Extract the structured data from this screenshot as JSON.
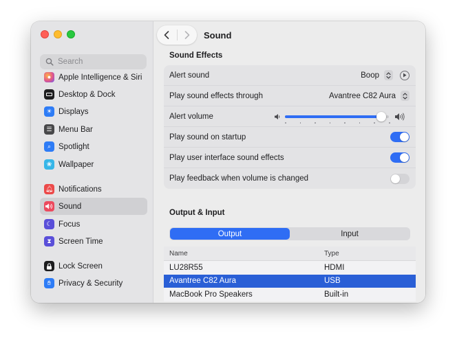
{
  "sidebar": {
    "search_placeholder": "Search",
    "items": [
      {
        "label": "Apple Intelligence & Siri",
        "color": "#e0568c"
      },
      {
        "label": "Desktop & Dock",
        "color": "#1d1d1f"
      },
      {
        "label": "Displays",
        "color": "#2e7cf6"
      },
      {
        "label": "Menu Bar",
        "color": "#1d1d1f"
      },
      {
        "label": "Spotlight",
        "color": "#2e7cf6"
      },
      {
        "label": "Wallpaper",
        "color": "#36b6e8"
      },
      {
        "label": "Notifications",
        "color": "#ec4a4a"
      },
      {
        "label": "Sound",
        "color": "#ec4a5e"
      },
      {
        "label": "Focus",
        "color": "#5a4fd9"
      },
      {
        "label": "Screen Time",
        "color": "#5a4fd9"
      },
      {
        "label": "Lock Screen",
        "color": "#1d1d1f"
      },
      {
        "label": "Privacy & Security",
        "color": "#2e7cf6"
      }
    ]
  },
  "header": {
    "title": "Sound"
  },
  "sound_effects": {
    "title": "Sound Effects",
    "alert_sound_label": "Alert sound",
    "alert_sound_value": "Boop",
    "output_through_label": "Play sound effects through",
    "output_through_value": "Avantree C82 Aura",
    "alert_volume_label": "Alert volume",
    "alert_volume_level": 0.93,
    "startup_label": "Play sound on startup",
    "startup_on": true,
    "ui_effects_label": "Play user interface sound effects",
    "ui_effects_on": true,
    "feedback_label": "Play feedback when volume is changed",
    "feedback_on": false
  },
  "output_input": {
    "title": "Output & Input",
    "tabs": [
      "Output",
      "Input"
    ],
    "active_tab": "Output",
    "columns": [
      "Name",
      "Type"
    ],
    "rows": [
      {
        "name": "LU28R55",
        "type": "HDMI"
      },
      {
        "name": "Avantree C82 Aura",
        "type": "USB"
      },
      {
        "name": "MacBook Pro Speakers",
        "type": "Built-in"
      }
    ],
    "selected_row": 1
  },
  "colors": {
    "accent": "#2f6df4",
    "selection": "#2a5fd6"
  }
}
